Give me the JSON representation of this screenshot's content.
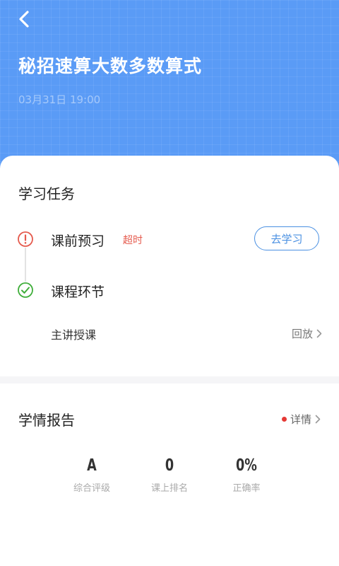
{
  "header": {
    "title": "秘招速算大数多数算式",
    "time": "03月31日 19:00"
  },
  "tasks": {
    "section_title": "学习任务",
    "items": [
      {
        "label": "课前预习",
        "status_tag": "超时",
        "action_label": "去学习",
        "icon": "alert-circle-icon"
      },
      {
        "label": "课程环节",
        "icon": "check-circle-icon"
      }
    ],
    "sub_item": {
      "label": "主讲授课",
      "action_label": "回放"
    }
  },
  "report": {
    "section_title": "学情报告",
    "details_label": "详情",
    "stats": [
      {
        "value": "A",
        "label": "综合评级"
      },
      {
        "value": "0",
        "label": "课上排名"
      },
      {
        "value": "0%",
        "label": "正确率"
      }
    ]
  },
  "colors": {
    "header_bg": "#5a9bf6",
    "accent_blue": "#4a90e2",
    "warning_red": "#e55a4d",
    "success_green": "#3fae3a"
  }
}
